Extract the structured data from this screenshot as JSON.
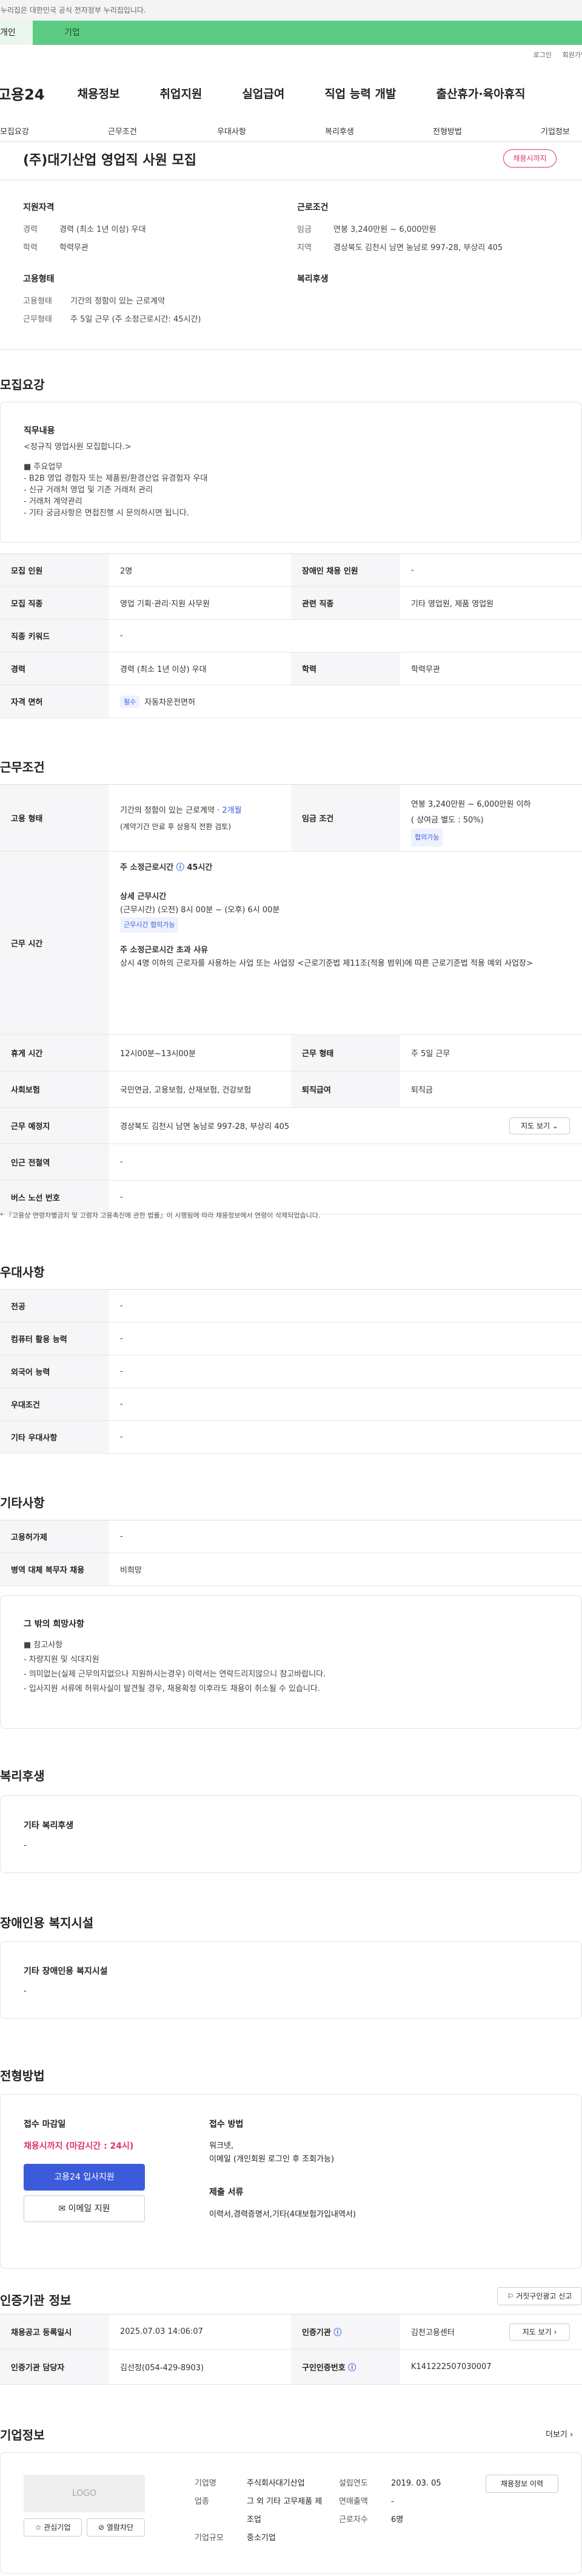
{
  "gov_bar": "이 누리집은 대한민국 공식 전자정부 누리집입니다.",
  "tabs": {
    "personal": "개인",
    "business": "기업"
  },
  "util": {
    "login": "로그인",
    "join": "회원가입"
  },
  "brand": "고용24",
  "gnb": [
    "채용정보",
    "취업지원",
    "실업급여",
    "직업 능력 개발",
    "출산휴가·육아휴직"
  ],
  "subnav": [
    "모집요강",
    "근무조건",
    "우대사항",
    "복리후생",
    "전형방법",
    "기업정보"
  ],
  "job": {
    "title": "(주)대기산업 영업직 사원 모집",
    "status": "채용시까지"
  },
  "summary": {
    "qual_h": "지원자격",
    "cond_h": "근로조건",
    "emp_h": "고용형태",
    "welfare_h": "복리후생",
    "career_k": "경력",
    "career_v": "경력 (최소 1년 이상) 우대",
    "edu_k": "학력",
    "edu_v": "학력무관",
    "wage_k": "임금",
    "wage_v": "연봉 3,240만원 ~ 6,000만원",
    "area_k": "지역",
    "area_v": "경상북도 김천시 남면 농남로 997-28, 부상리 405",
    "type_k": "고용형태",
    "type_v": "기간의 정함이 있는 근로계약",
    "hours_k": "근무형태",
    "hours_v": "주 5일 근무 (주 소정근로시간: 45시간)"
  },
  "recruit": {
    "title": "모집요강",
    "duty_h": "직무내용",
    "duty_lines": [
      "<정규직 영업사원 모집합니다.>",
      "",
      "■ 주요업무",
      "- B2B 영업 경험자 또는 제품원/환경산업 유경험자 우대",
      "- 신규 거래처 영업 및 기존 거래처 관리",
      "- 거래처 계약관리",
      "- 기타 궁금사항은 면접진행 시 문의하시면 됩니다."
    ],
    "rows": [
      {
        "k1": "모집 인원",
        "v1": "2명",
        "k2": "장애인 채용 인원",
        "v2": "-"
      },
      {
        "k1": "모집 직종",
        "v1": "영업 기획·관리·지원 사무원",
        "k2": "관련 직종",
        "v2": "기타 영업원, 제품 영업원"
      },
      {
        "k1": "직종 키워드",
        "v1": "-"
      },
      {
        "k1": "경력",
        "v1": "경력 (최소 1년 이상) 우대",
        "k2": "학력",
        "v2": "학력무관"
      },
      {
        "k1": "자격 면허",
        "chip": "필수",
        "v1": "자동차운전면허"
      }
    ]
  },
  "work": {
    "title": "근무조건",
    "type_k": "고용 형태",
    "type_v1": "기간의 정함이 있는 근로계약 · ",
    "type_link": "2개월",
    "type_v2": "(계약기간 만료 후 상용직 전환 검토)",
    "wage_k": "임금 조건",
    "wage_v1": "연봉 3,240만원 ~ 6,000만원 이하",
    "wage_v2": "( 상여금 별도 : 50%)",
    "wage_chip": "협의가능",
    "time_k": "근무 시간",
    "weekly": "주 소정근로시간",
    "weekly_v": "45시간",
    "detail_h": "상세 근무시간",
    "detail_v": "(근무시간) (오전) 8시 00분 ~ (오후) 6시 00분",
    "detail_chip": "근무시간 협의가능",
    "excess_h": "주 소정근로시간 초과 사유",
    "excess_v": "상시 4명 이하의 근로자를 사용하는 사업 또는 사업장 <근로기준법 제11조(적용 범위)에 따른 근로기준법 적용 예외 사업장>",
    "rows": [
      {
        "k1": "휴게 시간",
        "v1": "12시00분~13시00분",
        "k2": "근무 형태",
        "v2": "주 5일 근무"
      },
      {
        "k1": "사회보험",
        "v1": "국민연금, 고용보험, 산재보험, 건강보험",
        "k2": "퇴직급여",
        "v2": "퇴직금"
      },
      {
        "k1": "근무 예정지",
        "v1": "경상북도 김천시 남면 농남로 997-28, 부상리 405",
        "btn": "지도 보기"
      },
      {
        "k1": "인근 전철역",
        "v1": "-"
      },
      {
        "k1": "버스 노선 번호",
        "v1": "-"
      }
    ],
    "notice": "* 『고용상 연령차별금지 및 고령자 고용촉진에 관한 법률』이 시행됨에 따라 채용정보에서 연령이 삭제되었습니다."
  },
  "pref": {
    "title": "우대사항",
    "rows": [
      [
        "전공",
        "-"
      ],
      [
        "컴퓨터 활용 능력",
        "-"
      ],
      [
        "외국어 능력",
        "-"
      ],
      [
        "우대조건",
        "-"
      ],
      [
        "기타 우대사항",
        "-"
      ]
    ]
  },
  "etc": {
    "title": "기타사항",
    "rows": [
      [
        "고용허가제",
        "-"
      ],
      [
        "병역 대체 복무자 채용",
        "비희망"
      ]
    ],
    "other_h": "그 밖의 희망사항",
    "other_lines": [
      "■ 참고사항",
      "- 차량지원 및 식대지원",
      "- 의미없는(실제 근무의지없으나 지원하시는경우) 이력서는 연락드리지않으니 참고바랍니다.",
      "- 입사지원 서류에 허위사실이 발견될 경우, 채용확정 이후라도 채용이 취소될 수 있습니다."
    ]
  },
  "welfare": {
    "title": "복리후생",
    "sub": "기타 복리후생",
    "val": "-"
  },
  "disabled": {
    "title": "장애인용 복지시설",
    "sub": "기타 장애인용 복지시설",
    "val": "-"
  },
  "process": {
    "title": "전형방법",
    "deadline_h": "접수 마감일",
    "deadline_v": "채용시까지 (마감시간 : 24시)",
    "apply_btn": "고용24 입사지원",
    "email_btn": "이메일 지원",
    "method_h": "접수 방법",
    "method_v1": "워크넷,",
    "method_v2": "이메일 (개인회원 로그인 후 조회가능)",
    "docs_h": "제출 서류",
    "docs_v": "이력서,경력증명서,기타(4대보험가입내역서)"
  },
  "agency": {
    "title": "인증기관 정보",
    "report_btn": "거짓구인광고 신고",
    "reg_k": "채용공고 등록일시",
    "reg_v": "2025.07.03 14:06:07",
    "org_k": "인증기관",
    "org_v": "김천고용센터",
    "map_btn": "지도 보기",
    "mgr_k": "인증기관 담당자",
    "mgr_v": "김선정(054-429-8903)",
    "num_k": "구인인증번호",
    "num_v": "K141222507030007"
  },
  "company": {
    "title": "기업정보",
    "more": "더보기",
    "logo": "LOGO",
    "fav_btn": "관심기업",
    "block_btn": "열람차단",
    "name_k": "기업명",
    "name_v": "주식회사대기산업",
    "year_k": "설립연도",
    "year_v": "2019. 03. 05",
    "jobs_btn": "채용정보 이력",
    "biz_k": "업종",
    "biz_v": "그 외 기타 고무제품 제조업",
    "sales_k": "연매출액",
    "sales_v": "-",
    "emp_k": "근로자수",
    "emp_v": "6명",
    "size_k": "기업규모",
    "size_v": "중소기업"
  }
}
